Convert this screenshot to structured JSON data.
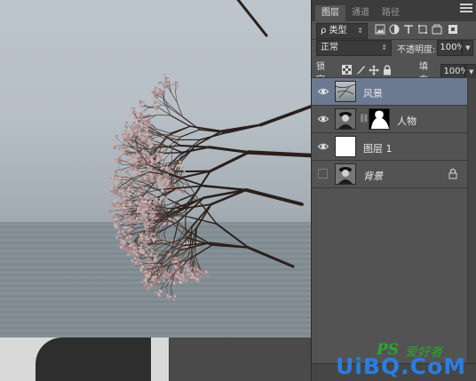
{
  "panel": {
    "tabs": [
      "图层",
      "通道",
      "路径"
    ],
    "active_tab": 0,
    "filter": {
      "label": "ρ 类型"
    },
    "blend_mode": "正常",
    "opacity_label": "不透明度:",
    "opacity_value": "100%",
    "lock_label": "锁定:",
    "fill_label": "填充:",
    "fill_value": "100%"
  },
  "layers": [
    {
      "name": "风景",
      "visible": true,
      "selected": true,
      "has_mask": false,
      "locked": false,
      "thumb": "landscape"
    },
    {
      "name": "人物",
      "visible": true,
      "selected": false,
      "has_mask": true,
      "locked": false,
      "thumb": "portrait"
    },
    {
      "name": "图层 1",
      "visible": true,
      "selected": false,
      "has_mask": false,
      "locked": false,
      "thumb": "white"
    },
    {
      "name": "背景",
      "visible": false,
      "selected": false,
      "has_mask": false,
      "locked": true,
      "thumb": "portrait"
    }
  ],
  "watermark": {
    "ps": "PS",
    "cn": "爱好者",
    "url": "UiBQ.CoM"
  },
  "colors": {
    "panel_bg": "#535353",
    "selected_layer": "#6b7a91",
    "watermark_green": "#2aa531",
    "watermark_blue": "#2a7de1"
  },
  "icons": {
    "filter_tools": [
      "image-filter-icon",
      "adjustment-filter-icon",
      "type-filter-icon",
      "shape-filter-icon",
      "smart-object-filter-icon",
      "filter-toggle-icon"
    ],
    "lock_tools": [
      "lock-transparent-pixels-icon",
      "lock-image-pixels-icon",
      "lock-position-icon",
      "lock-all-icon"
    ]
  }
}
